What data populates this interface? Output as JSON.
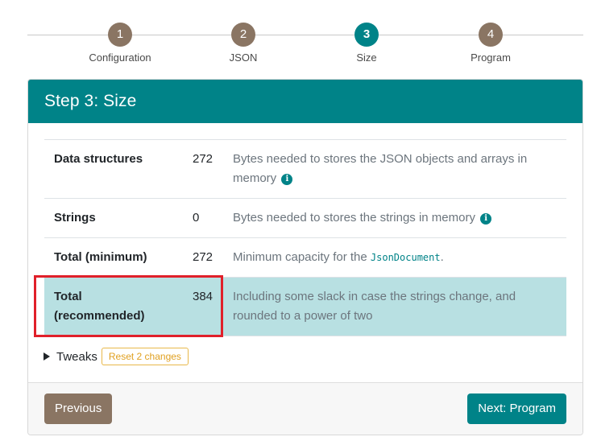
{
  "stepper": {
    "steps": [
      {
        "number": "1",
        "label": "Configuration"
      },
      {
        "number": "2",
        "label": "JSON"
      },
      {
        "number": "3",
        "label": "Size"
      },
      {
        "number": "4",
        "label": "Program"
      }
    ],
    "active_step": 3
  },
  "card": {
    "title": "Step 3: Size"
  },
  "size_table": {
    "rows": [
      {
        "name": "Data structures",
        "value": "272",
        "description": "Bytes needed to stores the JSON objects and arrays in memory",
        "info": true
      },
      {
        "name": "Strings",
        "value": "0",
        "description": "Bytes needed to stores the strings in memory",
        "info": true
      },
      {
        "name": "Total (minimum)",
        "value": "272",
        "description_prefix": "Minimum capacity for the",
        "code": "JsonDocument",
        "description_suffix": "."
      },
      {
        "name": "Total (recommended)",
        "value": "384",
        "description": "Including some slack in case the strings change, and rounded to a power of two",
        "highlighted": true
      }
    ]
  },
  "tweaks": {
    "label": "Tweaks",
    "reset_label": "Reset 2 changes"
  },
  "footer": {
    "previous_label": "Previous",
    "next_label": "Next: Program"
  },
  "colors": {
    "accent": "#008388",
    "step_inactive": "#8a7563",
    "highlight_row": "#b8e0e2",
    "annotation_box": "#e0202a",
    "reset_outline": "#e8b84a"
  }
}
